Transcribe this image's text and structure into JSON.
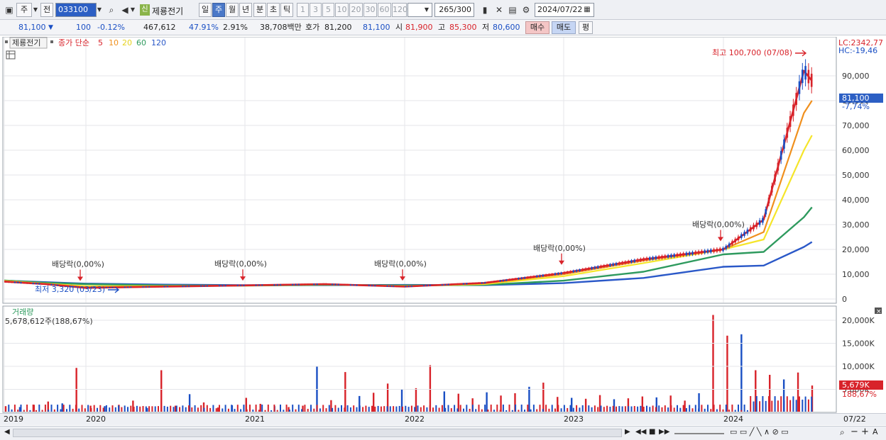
{
  "toolbar": {
    "type_label": "주",
    "prev_label": "전",
    "code_value": "033100",
    "new_badge": "신",
    "stock_name": "제룡전기",
    "periods": [
      "일",
      "주",
      "월",
      "년",
      "분",
      "초",
      "틱"
    ],
    "active_period": "주",
    "intervals": [
      "1",
      "3",
      "5",
      "10",
      "20",
      "30",
      "60",
      "120"
    ],
    "count_value": "265",
    "count_total": "/300",
    "date_value": "2024/07/22"
  },
  "quote": {
    "price": "81,100",
    "change": "100",
    "change_pct": "-0.12%",
    "volume": "467,612",
    "vol_ratio": "47.91%",
    "turnover": "2.91%",
    "amount": "38,708백만",
    "bid_label": "호가",
    "bid1": "81,200",
    "bid2": "81,100",
    "open_label": "시",
    "open": "81,900",
    "high_label": "고",
    "high": "85,300",
    "low_label": "저",
    "low": "80,600",
    "buy_label": "매수",
    "sell_label": "매도",
    "eval_label": "평"
  },
  "legend": {
    "name": "제룡전기",
    "prefix": "종가 단순",
    "ma": [
      {
        "period": "5",
        "color": "#d8232a"
      },
      {
        "period": "10",
        "color": "#f0901e"
      },
      {
        "period": "20",
        "color": "#f5e52a"
      },
      {
        "period": "60",
        "color": "#2e9a5e"
      },
      {
        "period": "120",
        "color": "#2a58c8"
      }
    ]
  },
  "annotations": {
    "max_label": "최고 100,700 (07/08)",
    "min_label": "최저 3,320 (03/23)",
    "dividend_label": "배당락(0,00%)",
    "dividend_count": 5
  },
  "price_axis": {
    "lc": "LC:2342,77",
    "hc": "HC:-19,46",
    "ticks": [
      "90,000",
      "80,000",
      "70,000",
      "60,000",
      "50,000",
      "40,000",
      "30,000",
      "20,000",
      "10,000",
      "0"
    ],
    "current": "81,100",
    "current_pct": "-7,74%"
  },
  "volume_panel": {
    "title": "거래량",
    "value": "5,678,612주(188,67%)",
    "ticks": [
      "20,000K",
      "15,000K",
      "10,000K",
      "5,000K"
    ],
    "current": "5,679K",
    "current_pct": "188,67%"
  },
  "x_axis": {
    "labels": [
      "2019",
      "2020",
      "2021",
      "2022",
      "2023",
      "2024"
    ],
    "end_label": "07/22"
  },
  "chart_data": {
    "type": "line",
    "title": "",
    "x": [
      "2019",
      "2019.5",
      "2020",
      "2020.5",
      "2021",
      "2021.5",
      "2022",
      "2022.5",
      "2023",
      "2023.5",
      "2024",
      "2024.25",
      "2024.5",
      "2024.55"
    ],
    "series": [
      {
        "name": "5",
        "values": [
          7000,
          6000,
          4500,
          5000,
          5500,
          6000,
          5000,
          6500,
          10500,
          16000,
          20000,
          32000,
          92000,
          88000
        ]
      },
      {
        "name": "10",
        "values": [
          7200,
          6100,
          4800,
          5100,
          5500,
          6000,
          5100,
          6300,
          10000,
          15500,
          20000,
          27000,
          75000,
          80000
        ]
      },
      {
        "name": "20",
        "values": [
          7300,
          6200,
          5200,
          5200,
          5400,
          5900,
          5200,
          6000,
          9200,
          14500,
          20000,
          24000,
          60000,
          66000
        ]
      },
      {
        "name": "60",
        "values": [
          7500,
          6600,
          6000,
          5500,
          5400,
          5700,
          5500,
          5700,
          7400,
          11000,
          18000,
          19000,
          33000,
          37000
        ]
      },
      {
        "name": "120",
        "values": [
          7400,
          6800,
          6200,
          5800,
          5600,
          5600,
          5700,
          5600,
          6400,
          8500,
          13000,
          13500,
          21000,
          23000
        ]
      }
    ],
    "ylim": [
      0,
      100700
    ],
    "yticks": [
      0,
      10000,
      20000,
      30000,
      40000,
      50000,
      60000,
      70000,
      80000,
      90000
    ],
    "volume": [
      1200,
      1000,
      1500,
      2200,
      1800,
      9500,
      1300,
      1200,
      1500,
      2400,
      800,
      9000,
      1300,
      3800,
      2000,
      900,
      1400,
      3000,
      1700,
      1200,
      1000,
      1300,
      9800,
      2500,
      8600,
      3400,
      4100,
      6100,
      4800,
      5100,
      10100,
      4400,
      3900,
      2900,
      4200,
      3500,
      4000,
      5400,
      6300,
      3200,
      3000,
      2800,
      3600,
      2700,
      2900,
      3300,
      3100,
      3500,
      2400,
      4000,
      21000,
      16500,
      16800,
      9000,
      8000,
      7000,
      8500,
      5679
    ],
    "max": 100700,
    "min": 3320
  }
}
